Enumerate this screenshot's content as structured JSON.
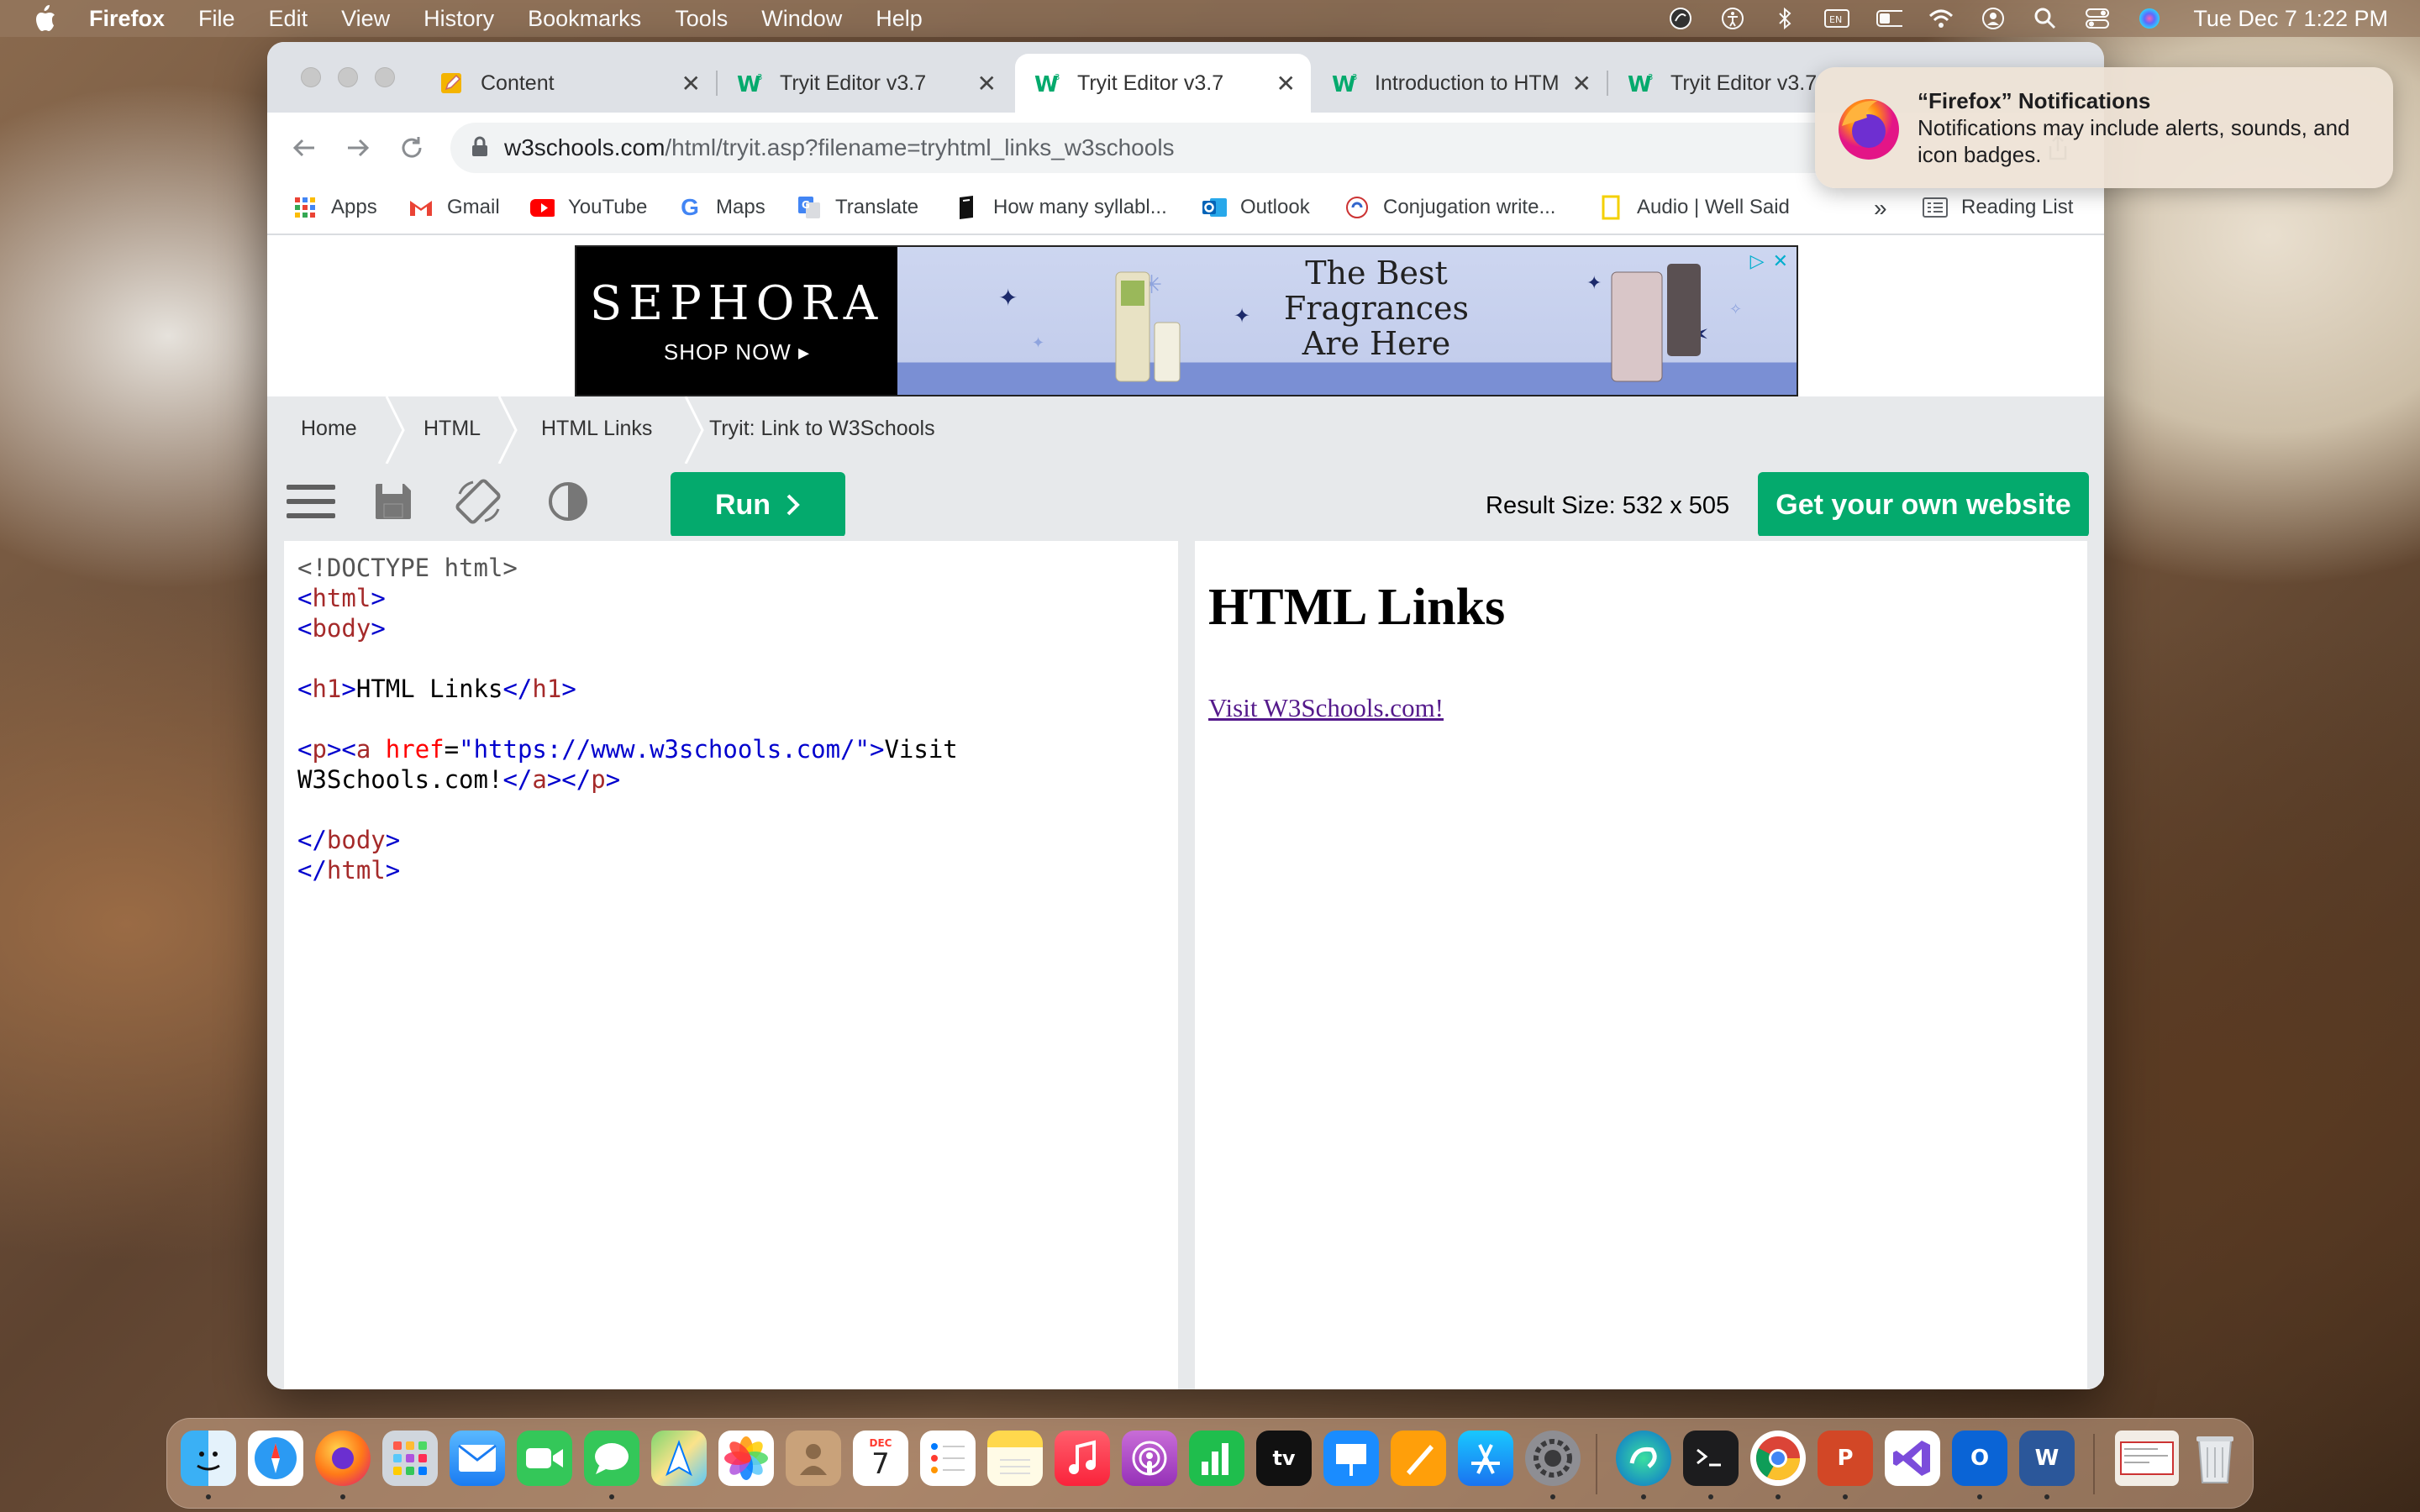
{
  "menubar": {
    "app_name": "Firefox",
    "items": [
      "File",
      "Edit",
      "View",
      "History",
      "Bookmarks",
      "Tools",
      "Window",
      "Help"
    ],
    "clock": "Tue Dec 7  1:22 PM",
    "status_icons": [
      "circle-status-icon",
      "accessibility-icon",
      "bluetooth-icon",
      "input-source-icon",
      "battery-icon",
      "wifi-icon",
      "user-icon",
      "spotlight-icon",
      "control-center-icon",
      "siri-icon"
    ]
  },
  "browser": {
    "tabs": [
      {
        "title": "Content",
        "icon": "pencil-note-icon",
        "active": false
      },
      {
        "title": "Tryit Editor v3.7",
        "icon": "w3schools-icon",
        "active": false
      },
      {
        "title": "Tryit Editor v3.7",
        "icon": "w3schools-icon",
        "active": true
      },
      {
        "title": "Introduction to HTM",
        "icon": "w3schools-icon",
        "active": false
      },
      {
        "title": "Tryit Editor v3.7",
        "icon": "w3schools-icon",
        "active": false
      }
    ],
    "url_host": "w3schools.com",
    "url_path": "/html/tryit.asp?filename=tryhtml_links_w3schools",
    "bookmarks": [
      {
        "label": "Apps",
        "icon": "apps-grid-icon"
      },
      {
        "label": "Gmail",
        "icon": "gmail-icon"
      },
      {
        "label": "YouTube",
        "icon": "youtube-icon"
      },
      {
        "label": "Maps",
        "icon": "google-icon"
      },
      {
        "label": "Translate",
        "icon": "translate-icon"
      },
      {
        "label": "How many syllabl...",
        "icon": "book-icon"
      },
      {
        "label": "Outlook",
        "icon": "outlook-icon"
      },
      {
        "label": "Conjugation write...",
        "icon": "conjugation-icon"
      },
      {
        "label": "Audio | Well Said",
        "icon": "bookmark-yellow-icon"
      }
    ],
    "bookmarks_overflow": "»",
    "reading_list": "Reading List"
  },
  "ad": {
    "brand": "SEPHORA",
    "cta": "SHOP NOW ▸",
    "headline": "The Best Fragrances Are Here"
  },
  "breadcrumb": [
    "Home",
    "HTML",
    "HTML Links",
    "Tryit: Link to W3Schools"
  ],
  "tryit": {
    "run_label": "Run",
    "result_size": "Result Size: 532 x 505",
    "own_site_label": "Get your own website"
  },
  "editor": {
    "doctype": "<!DOCTYPE html>",
    "html_open": "html",
    "body_open": "body",
    "h1_tag": "h1",
    "h1_text": "HTML Links",
    "p_tag": "p",
    "a_tag": "a",
    "href_attr": "href",
    "href_value": "\"https://www.w3schools.com/\"",
    "link_text_1": "Visit",
    "link_text_2": "W3Schools.com!"
  },
  "result": {
    "heading": "HTML Links",
    "link": "Visit W3Schools.com!"
  },
  "notification": {
    "title": "“Firefox” Notifications",
    "body": "Notifications may include alerts, sounds, and icon badges."
  },
  "dock": {
    "apps": [
      "Finder",
      "Safari",
      "Firefox",
      "Launchpad",
      "Mail",
      "FaceTime",
      "Messages",
      "Maps",
      "Photos",
      "Contacts",
      "Calendar",
      "Reminders",
      "Notes",
      "Music",
      "Podcasts",
      "Numbers",
      "TV",
      "Keynote",
      "Pages",
      "App Store",
      "System Preferences",
      "Edge Canary",
      "Terminal",
      "Chrome",
      "PowerPoint",
      "Visual Studio",
      "Outlook",
      "Word",
      "Downloads",
      "Trash"
    ],
    "calendar_month": "DEC",
    "calendar_day": "7",
    "tv_label": "tv"
  }
}
